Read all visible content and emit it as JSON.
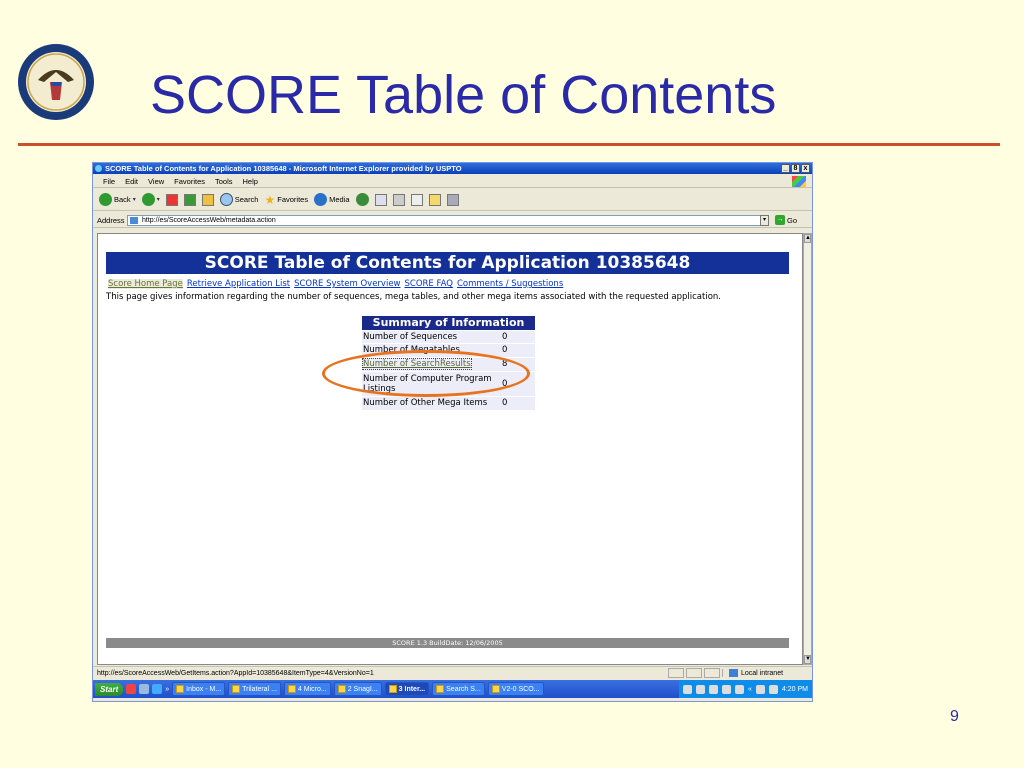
{
  "slide": {
    "title": "SCORE Table of Contents",
    "page_number": "9"
  },
  "window": {
    "title": "SCORE Table of Contents for Application 10385648 - Microsoft Internet Explorer provided by USPTO",
    "buttons": [
      "_",
      "8",
      "x"
    ]
  },
  "menu": [
    "File",
    "Edit",
    "View",
    "Favorites",
    "Tools",
    "Help"
  ],
  "toolbar": {
    "back": "Back",
    "search": "Search",
    "favorites": "Favorites",
    "media": "Media"
  },
  "address": {
    "label": "Address",
    "url": "http://es/ScoreAccessWeb/metadata.action",
    "go": "Go"
  },
  "page": {
    "header": "SCORE Table of Contents for Application 10385648",
    "nav_links": [
      "Score Home Page",
      "Retrieve Application List",
      "SCORE System Overview",
      "SCORE FAQ",
      "Comments / Suggestions"
    ],
    "intro": "This page gives information regarding the number of sequences, mega tables, and other mega items associated with the requested application.",
    "summary": {
      "title": "Summary of Information",
      "rows": [
        {
          "label": "Number of Sequences",
          "value": "0"
        },
        {
          "label": "Number of Megatables",
          "value": "0"
        },
        {
          "label": "Number of SearchResults",
          "value": "8"
        },
        {
          "label": "Number of Computer Program Listings",
          "value": "0"
        },
        {
          "label": "Number of Other Mega Items",
          "value": "0"
        }
      ]
    },
    "footer": "SCORE 1.3    BuildDate: 12/06/2005"
  },
  "status": {
    "url": "http://es/ScoreAccessWeb/GetItems.action?AppId=10385648&ItemType=4&VersionNo=1",
    "zone": "Local intranet"
  },
  "taskbar": {
    "start": "Start",
    "chevron": "»",
    "tasks": [
      "Inbox - M...",
      "Trilateral ...",
      "4 Micro...",
      "2 SnagI...",
      "3 Inter...",
      "Search S...",
      "V2-0 SCO..."
    ],
    "tray_chevron": "«",
    "clock": "4:20 PM"
  },
  "colors": {
    "slide_bg": "#fffee0",
    "title_blue": "#2a2aa8",
    "rule": "#c8502a",
    "header_blue": "#14319a",
    "highlight_oval": "#e8731e"
  }
}
